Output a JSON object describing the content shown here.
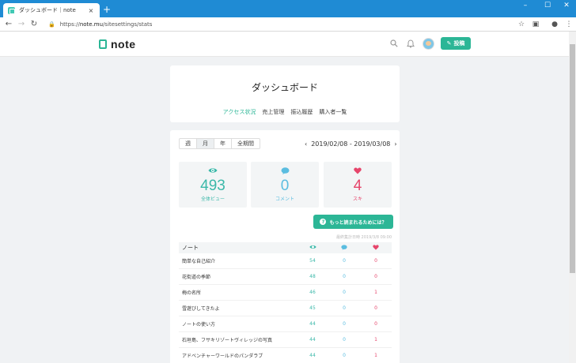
{
  "browser": {
    "tab_title": "ダッシュボード｜note",
    "tab_close": "×",
    "new_tab": "+",
    "url_scheme": "https://",
    "url_host": "note.mu",
    "url_path": "/sitesettings/stats",
    "win_min": "–",
    "win_max": "☐",
    "win_close": "✕"
  },
  "header": {
    "logo_text": "note",
    "post_label": "投稿"
  },
  "dashboard": {
    "title": "ダッシュボード",
    "tabs": [
      {
        "label": "アクセス状況",
        "active": true
      },
      {
        "label": "売上管理",
        "active": false
      },
      {
        "label": "振込履歴",
        "active": false
      },
      {
        "label": "購入者一覧",
        "active": false
      }
    ]
  },
  "stats": {
    "periods": [
      {
        "label": "週",
        "active": false
      },
      {
        "label": "月",
        "active": true
      },
      {
        "label": "年",
        "active": false
      },
      {
        "label": "全期間",
        "active": false
      }
    ],
    "range_prev": "‹",
    "range_text": "2019/02/08 - 2019/03/08",
    "range_next": "›",
    "views": {
      "value": "493",
      "label": "全体ビュー"
    },
    "comments": {
      "value": "0",
      "label": "コメント"
    },
    "likes": {
      "value": "4",
      "label": "スキ"
    },
    "more_button": "もっと読まれるためには？",
    "more_icon": "?",
    "updated_text": "最終集計日時 2019/3/8 09:00",
    "table_header": "ノート",
    "rows": [
      {
        "title": "簡単な自己紹介",
        "views": "54",
        "comments": "0",
        "likes": "0"
      },
      {
        "title": "花街道の季節",
        "views": "48",
        "comments": "0",
        "likes": "0"
      },
      {
        "title": "梅の名所",
        "views": "46",
        "comments": "0",
        "likes": "1"
      },
      {
        "title": "雪遊びしてきたよ",
        "views": "45",
        "comments": "0",
        "likes": "0"
      },
      {
        "title": "ノートの使い方",
        "views": "44",
        "comments": "0",
        "likes": "0"
      },
      {
        "title": "石垣島、フサキリゾートヴィレッジの写真",
        "views": "44",
        "comments": "0",
        "likes": "1"
      },
      {
        "title": "アドベンチャーワールドのパンダラブ",
        "views": "44",
        "comments": "0",
        "likes": "1"
      }
    ]
  },
  "colors": {
    "accent": "#2cb696",
    "views": "#3bb8a9",
    "comments": "#5bbde0",
    "likes": "#e6456b",
    "titlebar": "#1f8bd4"
  },
  "icons": [
    "eye-icon",
    "speech-bubble-icon",
    "heart-icon",
    "search-icon",
    "bell-icon",
    "pencil-icon"
  ]
}
